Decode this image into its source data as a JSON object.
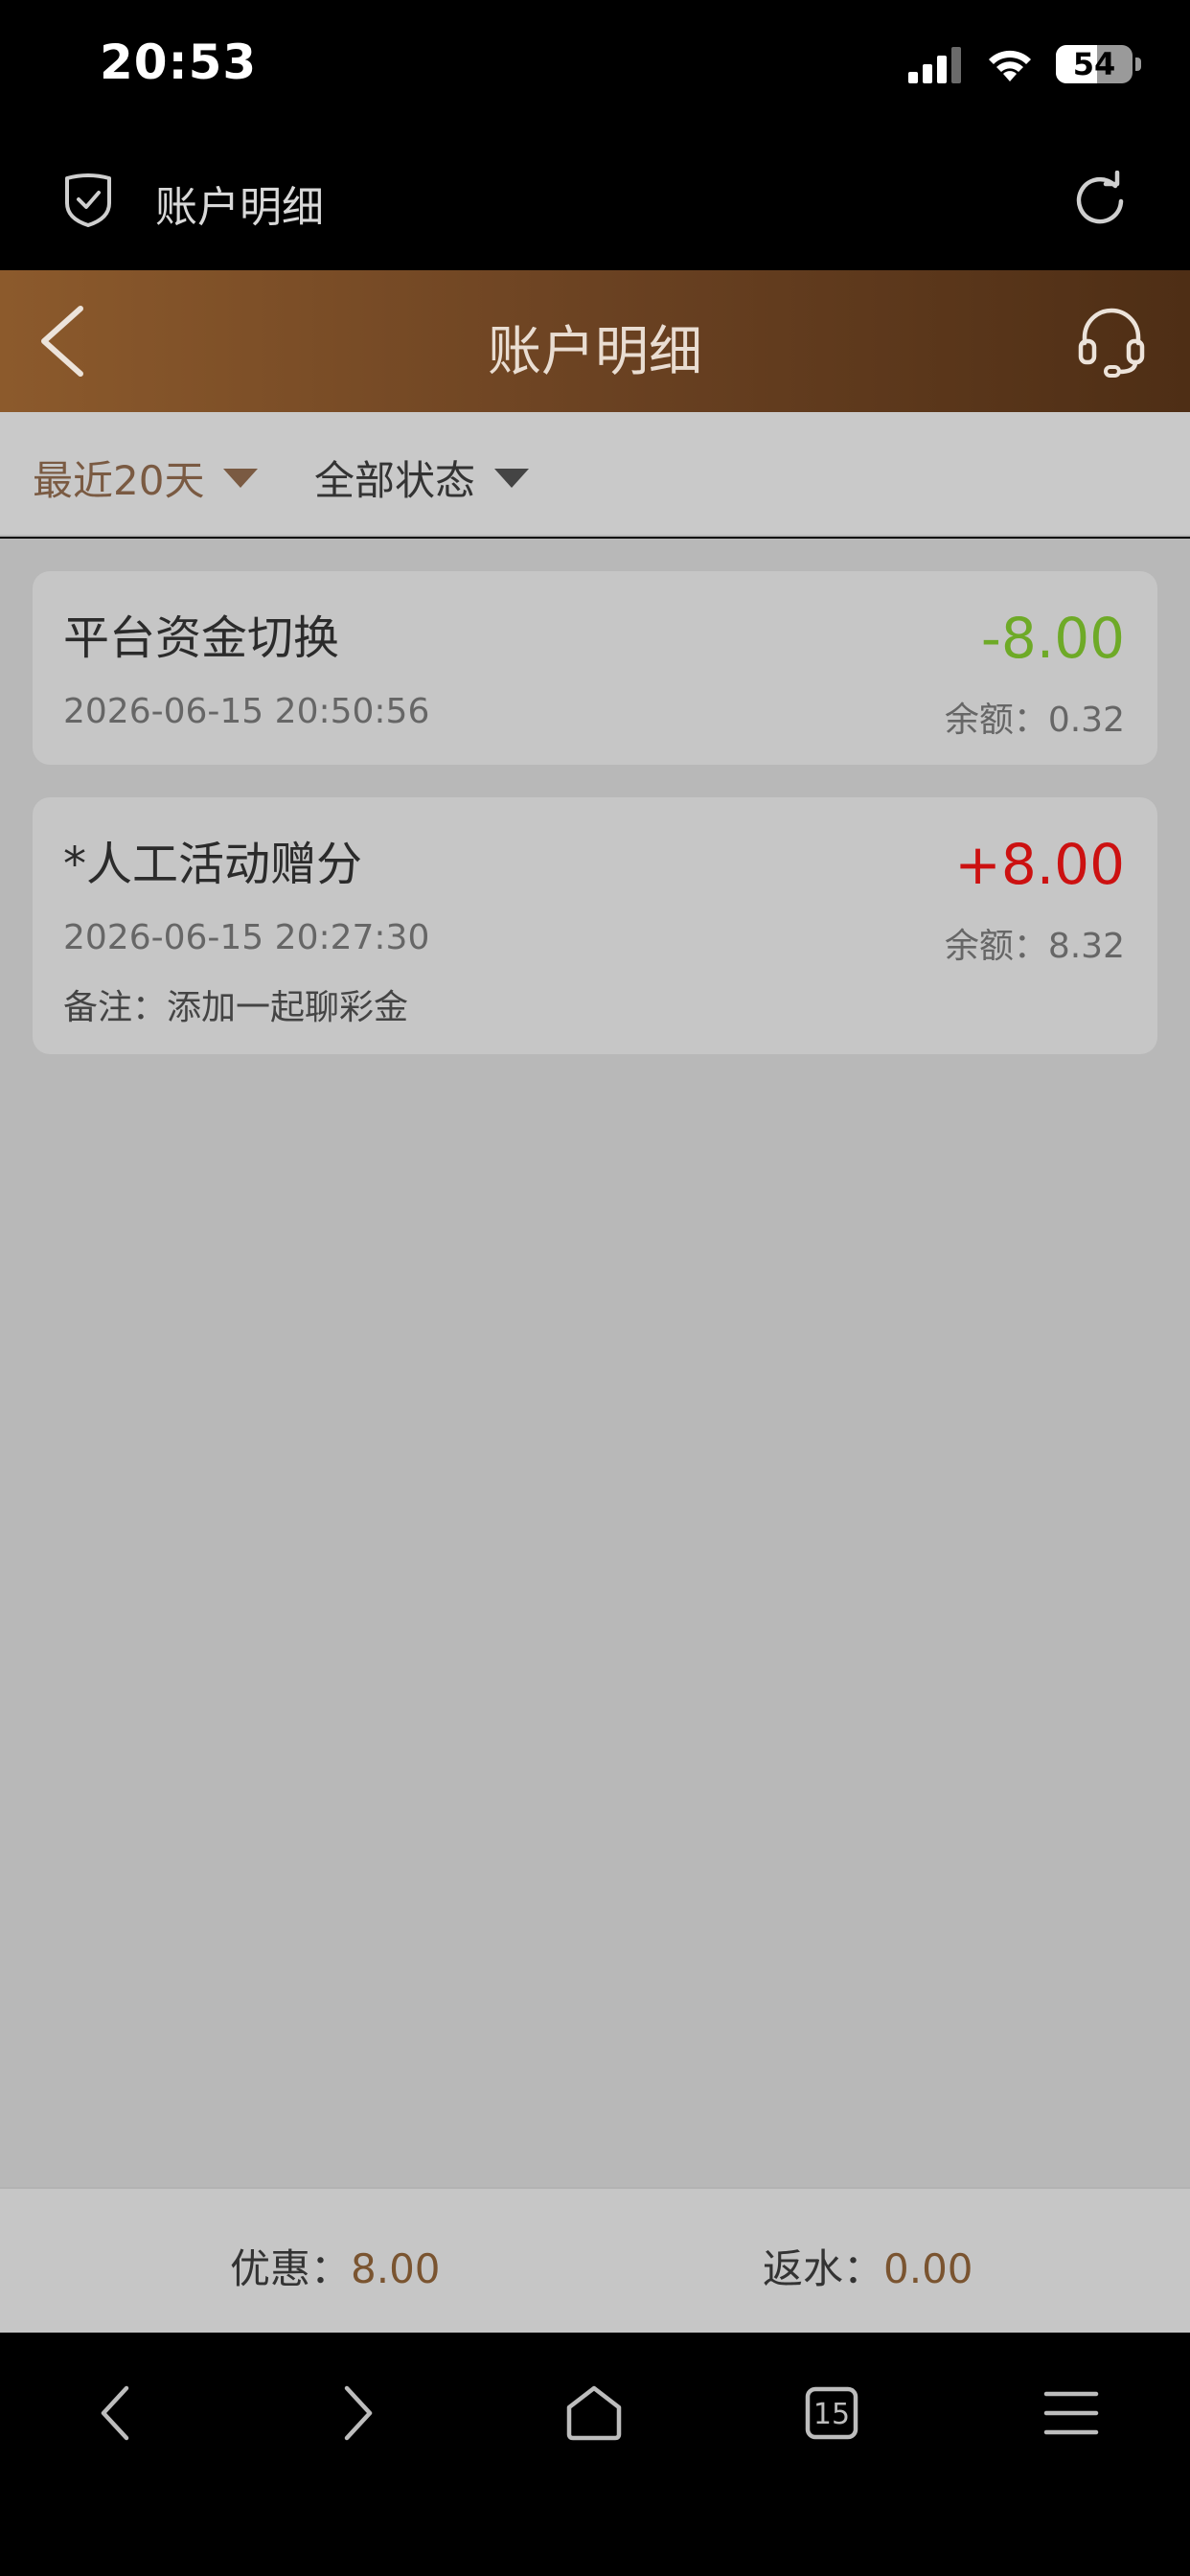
{
  "status_bar": {
    "time": "20:53",
    "battery_level": "54",
    "battery_fraction": 0.54
  },
  "browser": {
    "page_title": "账户明细"
  },
  "header": {
    "title": "账户明细"
  },
  "filters": {
    "date_range": "最近20天",
    "status": "全部状态"
  },
  "transactions": [
    {
      "title": "平台资金切换",
      "amount": "-8.00",
      "time": "2026-06-15 20:50:56",
      "balance": "余额：0.32"
    },
    {
      "title": "*人工活动赠分",
      "amount": "+8.00",
      "time": "2026-06-15 20:27:30",
      "balance": "余额：8.32",
      "note": "备注：添加一起聊彩金"
    }
  ],
  "summary": {
    "promo_label": "优惠：",
    "promo_value": "8.00",
    "rebate_label": "返水：",
    "rebate_value": "0.00"
  },
  "toolbar": {
    "tabs_count": "15"
  },
  "colors": {
    "header_gradient_start": "#8c5a2c",
    "header_gradient_end": "#4e2e15",
    "negative_amount": "#6eaa27",
    "positive_amount": "#cc1111",
    "accent_brown": "#7a5a42"
  },
  "icons": {
    "browser": [
      "shield-check-icon",
      "reload-icon"
    ],
    "header": [
      "chevron-left-icon",
      "headset-icon"
    ],
    "toolbar": [
      "back-arrow-icon",
      "forward-arrow-icon",
      "home-icon",
      "tabs-icon",
      "menu-icon"
    ]
  }
}
